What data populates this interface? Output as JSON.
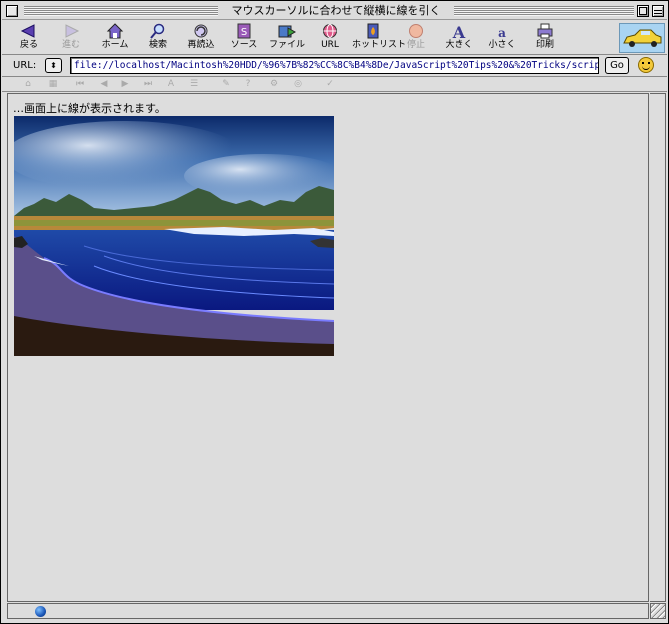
{
  "window": {
    "title": "マウスカーソルに合わせて縦横に線を引く"
  },
  "toolbar": {
    "items": [
      {
        "label": "戻る",
        "icon": "back-arrow-icon",
        "enabled": true
      },
      {
        "label": "進む",
        "icon": "forward-arrow-icon",
        "enabled": false
      },
      {
        "label": "ホーム",
        "icon": "home-icon",
        "enabled": true
      },
      {
        "label": "検索",
        "icon": "search-magnifier-icon",
        "enabled": true
      },
      {
        "label": "再読込",
        "icon": "reload-icon",
        "enabled": true
      },
      {
        "label": "ソース",
        "icon": "source-icon",
        "enabled": true
      },
      {
        "label": "ファイル",
        "icon": "file-icon",
        "enabled": true
      },
      {
        "label": "URL",
        "icon": "url-globe-icon",
        "enabled": true
      },
      {
        "label": "ホットリスト",
        "icon": "hotlist-icon",
        "enabled": true
      },
      {
        "label": "停止",
        "icon": "stop-icon",
        "enabled": false
      },
      {
        "label": "大きく",
        "icon": "larger-text-icon",
        "enabled": true
      },
      {
        "label": "小さく",
        "icon": "smaller-text-icon",
        "enabled": true
      },
      {
        "label": "印刷",
        "icon": "print-icon",
        "enabled": true
      }
    ]
  },
  "location": {
    "label": "URL:",
    "value": "file://localhost/Macintosh%20HDD/%96%7B%82%CC%8C%B4%8De/JavaScript%20Tips%20&%20Tricks/scrip",
    "go_label": "Go"
  },
  "content": {
    "text": "…画面上に線が表示されます。"
  },
  "colors": {
    "chrome": "#dddddd",
    "url_text": "#000080",
    "car_badge": "#a9d4f2"
  }
}
